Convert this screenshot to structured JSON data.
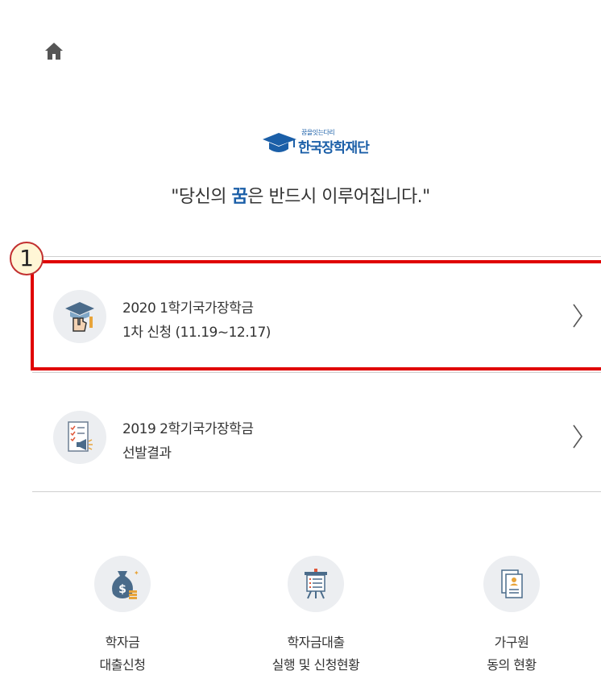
{
  "header": {
    "home_icon": "home-icon"
  },
  "logo": {
    "small_text": "꿈을잇는다리",
    "text": "한국장학재단",
    "color": "#1b5fa8"
  },
  "slogan": {
    "before": "\"당신의 ",
    "highlight": "꿈",
    "after": "은 반드시 이루어집니다.\""
  },
  "step_badge": "1",
  "highlight_color": "#e00000",
  "menu": [
    {
      "line1": "2020 1학기국가장학금",
      "line2": "1차 신청 (11.19~12.17)",
      "icon": "graduation-hand-icon"
    },
    {
      "line1": "2019 2학기국가장학금",
      "line2": "선발결과",
      "icon": "checklist-megaphone-icon"
    }
  ],
  "quick_links": [
    {
      "line1": "학자금",
      "line2": "대출신청",
      "icon": "money-bag-icon"
    },
    {
      "line1": "학자금대출",
      "line2": "실행 및 신청현황",
      "icon": "presentation-board-icon"
    },
    {
      "line1": "가구원",
      "line2": "동의 현황",
      "icon": "documents-icon"
    }
  ]
}
